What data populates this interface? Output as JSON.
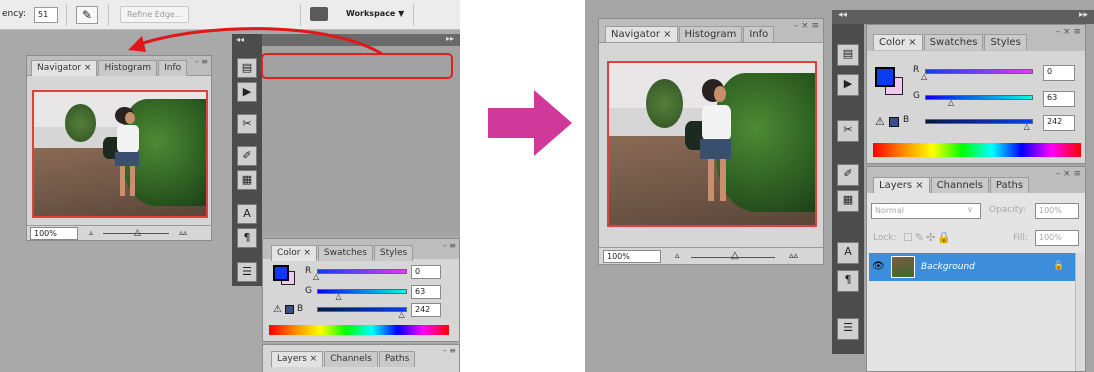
{
  "options_bar": {
    "tolerance_label": "ency:",
    "tolerance_value": "51",
    "refine_edge_label": "Refine Edge...",
    "workspace_label": "Workspace ▼"
  },
  "navigator_panel": {
    "tabs": [
      "Navigator ×",
      "Histogram",
      "Info"
    ],
    "zoom_value": "100%"
  },
  "color_panel": {
    "tabs": [
      "Color ×",
      "Swatches",
      "Styles"
    ],
    "r_label": "R",
    "g_label": "G",
    "b_label": "B",
    "r_value": "0",
    "g_value": "63",
    "b_value": "242",
    "r_fraction": 0,
    "g_fraction": 0.25,
    "b_fraction": 0.95,
    "foreground_color": "#0a3df2",
    "background_color": "#f0c8f0"
  },
  "layers_panel": {
    "tabs": [
      "Layers ×",
      "Channels",
      "Paths"
    ],
    "blend_mode": "Normal",
    "opacity_label": "Opacity:",
    "opacity_value": "100%",
    "lock_label": "Lock:",
    "fill_label": "Fill:",
    "fill_value": "100%",
    "layer_name": "Background"
  },
  "colors": {
    "arrow_red": "#e0161b",
    "transition_arrow": "#d0399a",
    "highlight_border": "#e02020",
    "layer_selected": "#3c8edc"
  }
}
